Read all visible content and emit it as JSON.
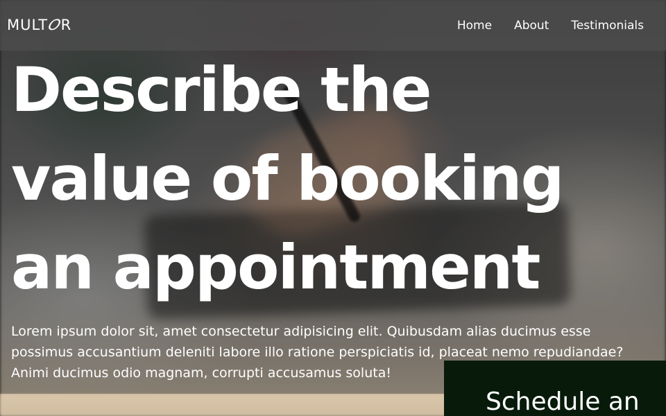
{
  "header": {
    "brand": "MULTOR",
    "nav": [
      {
        "label": "Home"
      },
      {
        "label": "About"
      },
      {
        "label": "Testimonials"
      }
    ]
  },
  "hero": {
    "title": "Describe the value of booking an appointment",
    "description": "Lorem ipsum dolor sit, amet consectetur adipisicing elit. Quibusdam alias ducimus esse possimus accusantium deleniti labore illo ratione perspiciatis id, placeat nemo repudiandae? Animi ducimus odio magnam, corrupti accusamus soluta!"
  },
  "schedule": {
    "title": "Schedule an"
  },
  "colors": {
    "nav_background": "#4e4e4e",
    "panel_background": "#081b0b",
    "text": "#ffffff"
  }
}
